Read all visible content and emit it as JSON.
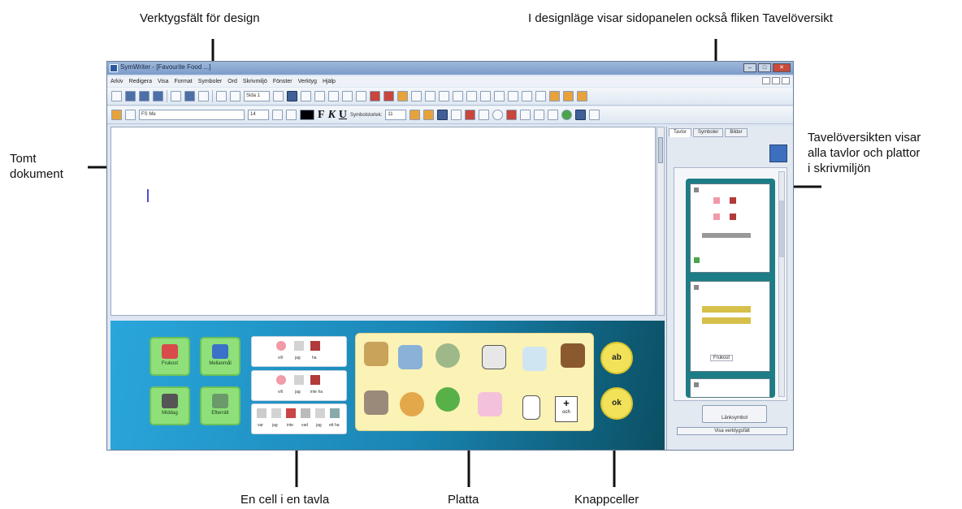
{
  "callouts": {
    "toolbar_design": "Verktygsfält för design",
    "side_panel": "I designläge visar sidopanelen också fliken Tavelöversikt",
    "empty_doc_line1": "Tomt",
    "empty_doc_line2": "dokument",
    "overview_line1": "Tavelöversikten visar",
    "overview_line2": "alla tavlor och plattor",
    "overview_line3": "i skrivmiljön",
    "cell_in_board": "En cell i en tavla",
    "platta": "Platta",
    "button_cells": "Knappceller"
  },
  "window": {
    "title": "SymWriter - [Favourite Food ...]"
  },
  "menu": [
    "Arkiv",
    "Redigera",
    "Visa",
    "Format",
    "Symboler",
    "Ord",
    "Skrivmiljö",
    "Fönster",
    "Verktyg",
    "Hjälp"
  ],
  "toolbar": {
    "page_field": "Sida 1",
    "font_name": "FS Me",
    "font_size": "14",
    "bold": "F",
    "italic": "K",
    "underline": "U",
    "symbol_size_label": "Symbolstorlek:",
    "symbol_size": "11"
  },
  "board": {
    "green_cells": [
      "Frukost",
      "Mellanmål",
      "Middag",
      "Efterrätt"
    ],
    "word_rows": [
      [
        "vill",
        "jag",
        "ha"
      ],
      [
        "vill",
        "jag",
        "inte ha"
      ],
      [
        "var",
        "jag",
        "inte",
        "vad",
        "jag",
        "ett ha"
      ]
    ],
    "platta_last_label": "och",
    "button_cells": [
      "ab",
      "ok"
    ]
  },
  "sidepanel": {
    "tabs": [
      "Tavlor",
      "Symboler",
      "Bilder"
    ],
    "card_label": "Frukost",
    "link_button": "Länksymbol",
    "bottom_button": "Visa verktygsfält"
  },
  "colors": {
    "board_start": "#2aa6dc",
    "board_end": "#0b4f63",
    "green_cell": "#8fe07a",
    "platta_bg": "#fbf2b6",
    "button_cell": "#f2e25a",
    "caret": "#4a50d8"
  }
}
